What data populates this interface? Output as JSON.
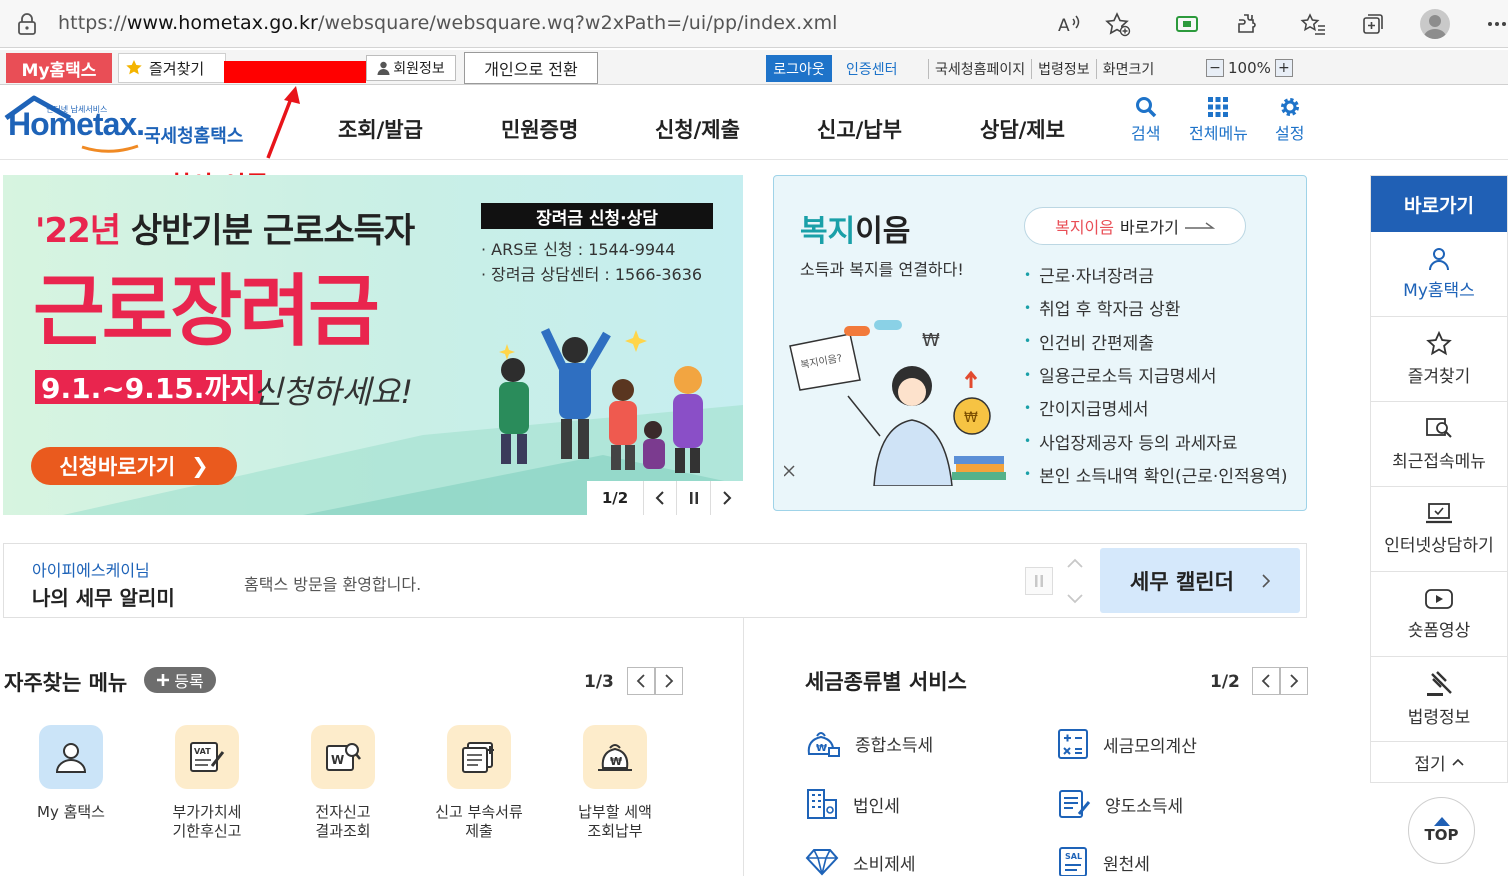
{
  "browser": {
    "url_prefix": "https://",
    "url_host": "www.hometax.go.kr",
    "url_path": "/websquare/websquare.wq?w2xPath=/ui/pp/index.xml"
  },
  "utility_bar": {
    "my_hometax": "My홈택스",
    "favorites": "즐겨찾기",
    "member_info": "회원정보",
    "switch_personal": "개인으로 전환",
    "logout": "로그아웃",
    "cert_center": "인증센터",
    "links": [
      "국세청홈페이지",
      "법령정보",
      "화면크기"
    ],
    "zoom_minus": "−",
    "zoom_value": "100%",
    "zoom_plus": "+"
  },
  "annotation": {
    "label": "회사 이름",
    "color": "#e8141a"
  },
  "header": {
    "logo_tagline": "인터넷 납세서비스",
    "logo_home": "Home",
    "logo_tax": "tax.",
    "logo_kor": "국세청홈택스",
    "nav": [
      "조회/발급",
      "민원증명",
      "신청/제출",
      "신고/납부",
      "상담/제보"
    ],
    "search": "검색",
    "all_menu": "전체메뉴",
    "settings": "설정"
  },
  "banner": {
    "line1_year": "'22년",
    "line1_rest": "상반기분 근로소득자",
    "line2": "근로장려금",
    "date": "9.1.~9.15.까지",
    "please": "신청하세요!",
    "go_button": "신청바로가기",
    "tag": "장려금 신청·상담",
    "ars": "· ARS로 신청 : 1544-9944",
    "center": "· 장려금 상담센터 : 1566-3636",
    "page": "1/2",
    "bubble": "복지이음?"
  },
  "welfare": {
    "title_a": "복지",
    "title_b": "이음",
    "subtitle": "소득과 복지를 연결하다!",
    "button_red": "복지이음",
    "button_rest": "바로가기",
    "items": [
      "근로·자녀장려금",
      "취업 후 학자금 상환",
      "인건비 간편제출",
      "일용근로소득 지급명세서",
      "간이지급명세서",
      "사업장제공자 등의 과세자료",
      "본인 소득내역 확인(근로·인적용역)"
    ]
  },
  "quick": {
    "title": "바로가기",
    "items": [
      "My홈택스",
      "즐겨찾기",
      "최근접속메뉴",
      "인터넷상담하기",
      "숏폼영상",
      "법령정보"
    ],
    "fold": "접기",
    "top": "TOP"
  },
  "alarm": {
    "company": "아이피에스케이님",
    "title": "나의 세무 알리미",
    "welcome": "홈택스 방문을 환영합니다.",
    "calendar": "세무 캘린더"
  },
  "frequent": {
    "title": "자주찾는 메뉴",
    "register": "등록",
    "page": "1/3",
    "items": [
      {
        "line1": "My 홈택스",
        "line2": ""
      },
      {
        "line1": "부가가치세",
        "line2": "기한후신고"
      },
      {
        "line1": "전자신고",
        "line2": "결과조회"
      },
      {
        "line1": "신고 부속서류",
        "line2": "제출"
      },
      {
        "line1": "납부할 세액",
        "line2": "조회납부"
      }
    ]
  },
  "services": {
    "title": "세금종류별 서비스",
    "page": "1/2",
    "items": [
      "종합소득세",
      "세금모의계산",
      "법인세",
      "양도소득세",
      "소비제세",
      "원천세"
    ]
  },
  "colors": {
    "brand_blue": "#1e63b8",
    "accent_red": "#e94e56",
    "banner_pink": "#e9254e"
  }
}
